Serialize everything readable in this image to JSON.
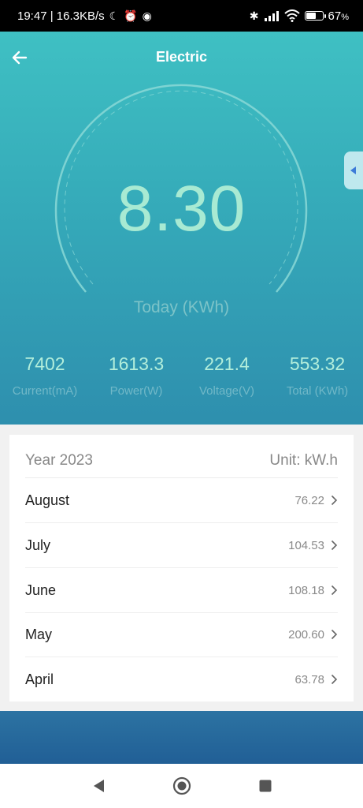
{
  "status_bar": {
    "time_speed": "19:47 | 16.3KB/s",
    "battery": "67",
    "battery_unit": "%",
    "battery_level": 0.67
  },
  "header": {
    "title": "Electric"
  },
  "gauge": {
    "value": "8.30",
    "label": "Today (KWh)"
  },
  "stats": [
    {
      "value": "7402",
      "label": "Current(mA)"
    },
    {
      "value": "1613.3",
      "label": "Power(W)"
    },
    {
      "value": "221.4",
      "label": "Voltage(V)"
    },
    {
      "value": "553.32",
      "label": "Total (KWh)"
    }
  ],
  "monthly": {
    "year_label": "Year 2023",
    "unit_label": "Unit: kW.h",
    "rows": [
      {
        "month": "August",
        "value": "76.22"
      },
      {
        "month": "July",
        "value": "104.53"
      },
      {
        "month": "June",
        "value": "108.18"
      },
      {
        "month": "May",
        "value": "200.60"
      },
      {
        "month": "April",
        "value": "63.78"
      }
    ]
  },
  "colors": {
    "hero_top": "#3fc0c3",
    "hero_bottom": "#2e8fae",
    "gauge_value": "#a8ead3",
    "footer_band": "#215f96"
  }
}
